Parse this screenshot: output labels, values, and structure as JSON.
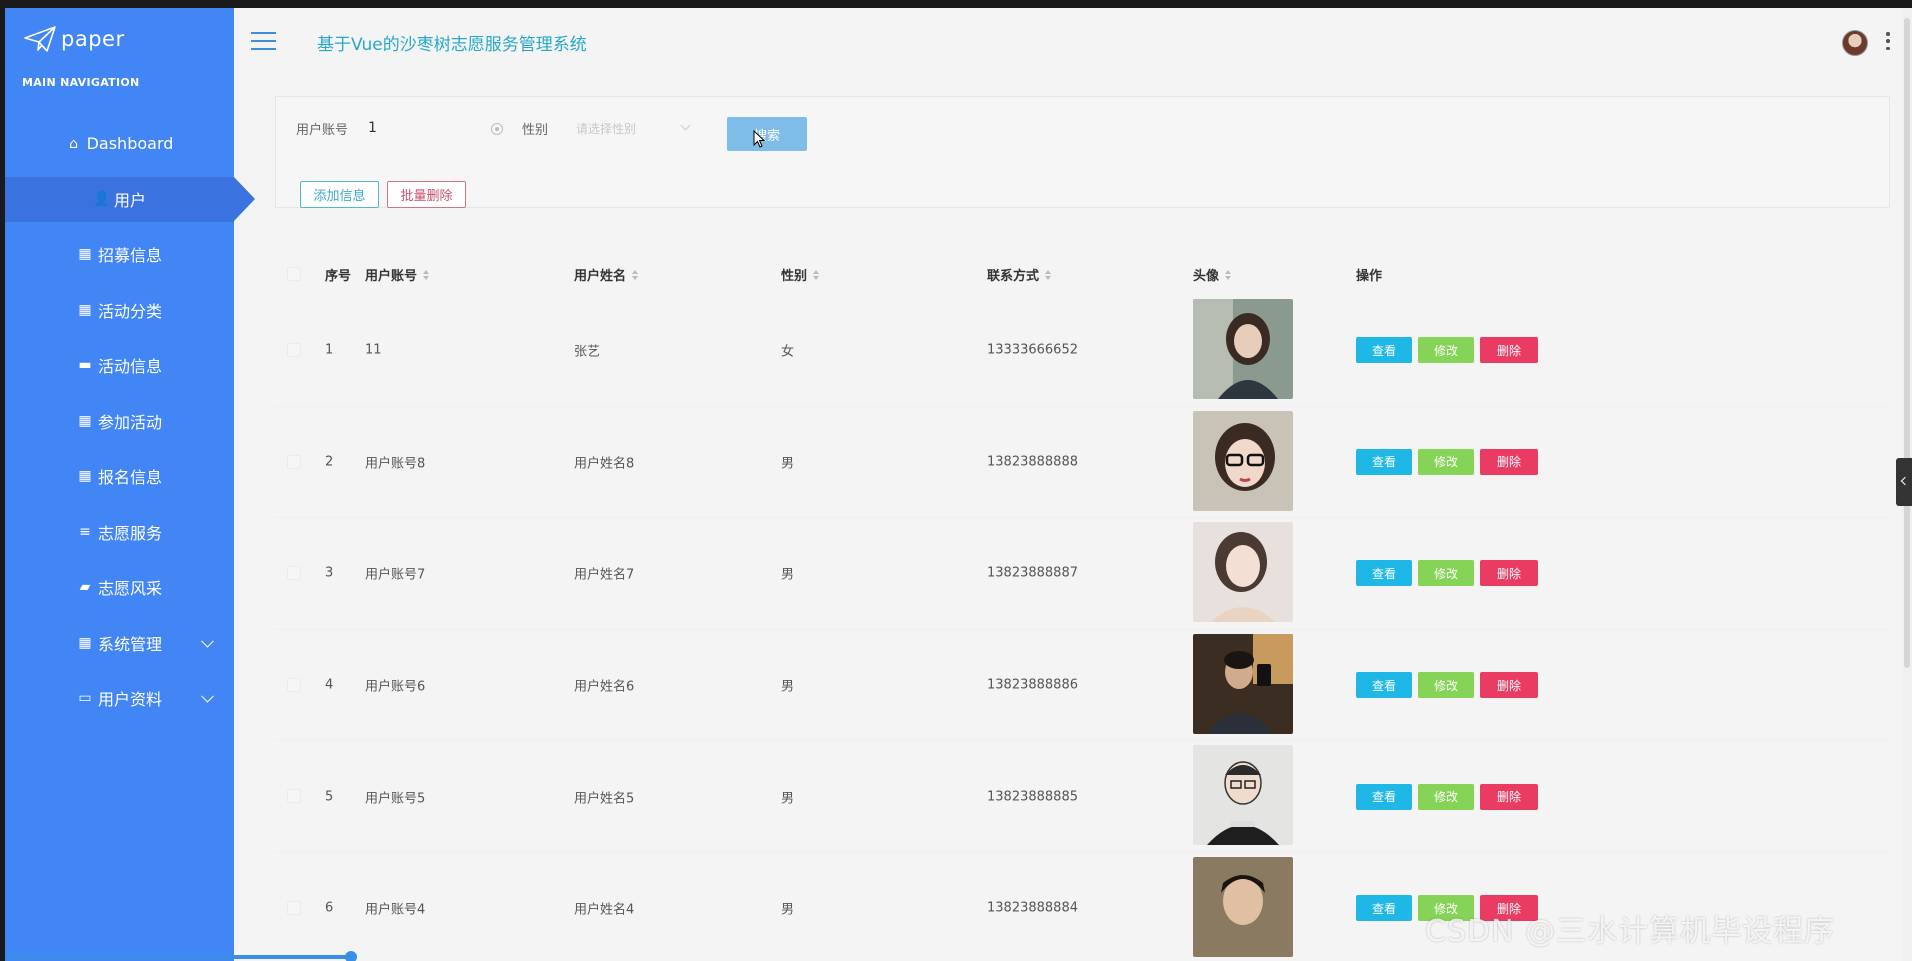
{
  "app": {
    "logo_text": "paper",
    "system_title": "基于Vue的沙枣树志愿服务管理系统"
  },
  "sidebar": {
    "nav_title": "MAIN NAVIGATION",
    "items": [
      {
        "label": "Dashboard",
        "icon": "home-icon"
      },
      {
        "label": "用户",
        "icon": "user-icon",
        "active": true
      },
      {
        "label": "招募信息",
        "icon": "grid-icon"
      },
      {
        "label": "活动分类",
        "icon": "grid-icon"
      },
      {
        "label": "活动信息",
        "icon": "monitor-icon"
      },
      {
        "label": "参加活动",
        "icon": "grid-icon"
      },
      {
        "label": "报名信息",
        "icon": "grid-icon"
      },
      {
        "label": "志愿服务",
        "icon": "sliders-icon"
      },
      {
        "label": "志愿风采",
        "icon": "briefcase-icon"
      },
      {
        "label": "系统管理",
        "icon": "grid-icon",
        "expandable": true
      },
      {
        "label": "用户资料",
        "icon": "card-icon",
        "expandable": true
      }
    ]
  },
  "search": {
    "account_label": "用户账号",
    "account_value": "1",
    "gender_label": "性别",
    "gender_placeholder": "请选择性别",
    "search_button": "搜索",
    "add_button": "添加信息",
    "batch_delete_button": "批量删除"
  },
  "table": {
    "columns": [
      "序号",
      "用户账号",
      "用户姓名",
      "性别",
      "联系方式",
      "头像",
      "操作"
    ],
    "rows": [
      {
        "index": "1",
        "account": "11",
        "name": "张艺",
        "gender": "女",
        "phone": "13333666652"
      },
      {
        "index": "2",
        "account": "用户账号8",
        "name": "用户姓名8",
        "gender": "男",
        "phone": "13823888888"
      },
      {
        "index": "3",
        "account": "用户账号7",
        "name": "用户姓名7",
        "gender": "男",
        "phone": "13823888887"
      },
      {
        "index": "4",
        "account": "用户账号6",
        "name": "用户姓名6",
        "gender": "男",
        "phone": "13823888886"
      },
      {
        "index": "5",
        "account": "用户账号5",
        "name": "用户姓名5",
        "gender": "男",
        "phone": "13823888885"
      },
      {
        "index": "6",
        "account": "用户账号4",
        "name": "用户姓名4",
        "gender": "男",
        "phone": "13823888884"
      }
    ],
    "actions": {
      "view": "查看",
      "edit": "修改",
      "delete": "删除"
    }
  },
  "watermark": "CSDN @三水计算机毕设程序",
  "colors": {
    "sidebar": "#4285f4",
    "title": "#28a8c7",
    "view": "#1fb8e6",
    "edit": "#85d357",
    "delete": "#ea3c63"
  }
}
